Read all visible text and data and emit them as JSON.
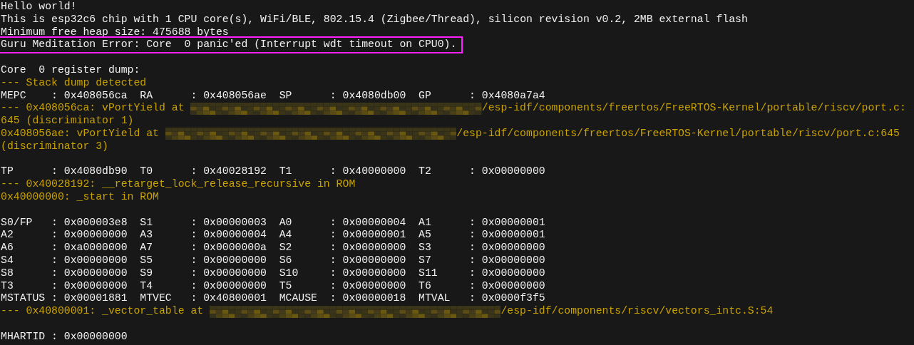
{
  "terminal": {
    "lines": [
      {
        "kind": "text",
        "text": "Hello world!"
      },
      {
        "kind": "text",
        "text": "This is esp32c6 chip with 1 CPU core(s), WiFi/BLE, 802.15.4 (Zigbee/Thread), silicon revision v0.2, 2MB external flash"
      },
      {
        "kind": "text",
        "text": "Minimum free heap size: 475688 bytes"
      },
      {
        "kind": "boxed",
        "text": "Guru Meditation Error: Core  0 panic'ed (Interrupt wdt timeout on CPU0)."
      },
      {
        "kind": "blank"
      },
      {
        "kind": "text",
        "text": "Core  0 register dump:"
      },
      {
        "kind": "note",
        "text": "--- Stack dump detected"
      },
      {
        "kind": "text",
        "text": "MEPC    : 0x408056ca  RA      : 0x408056ae  SP      : 0x4080db00  GP      : 0x4080a7a4"
      },
      {
        "kind": "redacted",
        "before": "--- 0x408056ca: vPortYield at ",
        "after": "/esp-idf/components/freertos/FreeRTOS-Kernel/portable/riscv/port.c:"
      },
      {
        "kind": "note",
        "text": "645 (discriminator 1)"
      },
      {
        "kind": "redacted",
        "before": "0x408056ae: vPortYield at ",
        "after": "/esp-idf/components/freertos/FreeRTOS-Kernel/portable/riscv/port.c:645"
      },
      {
        "kind": "note",
        "text": "(discriminator 3)"
      },
      {
        "kind": "blank"
      },
      {
        "kind": "text",
        "text": "TP      : 0x4080db90  T0      : 0x40028192  T1      : 0x40000000  T2      : 0x00000000"
      },
      {
        "kind": "note",
        "text": "--- 0x40028192: __retarget_lock_release_recursive in ROM"
      },
      {
        "kind": "note",
        "text": "0x40000000: _start in ROM"
      },
      {
        "kind": "blank"
      },
      {
        "kind": "text",
        "text": "S0/FP   : 0x000003e8  S1      : 0x00000003  A0      : 0x00000004  A1      : 0x00000001"
      },
      {
        "kind": "text",
        "text": "A2      : 0x00000000  A3      : 0x00000004  A4      : 0x00000001  A5      : 0x00000001"
      },
      {
        "kind": "text",
        "text": "A6      : 0xa0000000  A7      : 0x0000000a  S2      : 0x00000000  S3      : 0x00000000"
      },
      {
        "kind": "text",
        "text": "S4      : 0x00000000  S5      : 0x00000000  S6      : 0x00000000  S7      : 0x00000000"
      },
      {
        "kind": "text",
        "text": "S8      : 0x00000000  S9      : 0x00000000  S10     : 0x00000000  S11     : 0x00000000"
      },
      {
        "kind": "text",
        "text": "T3      : 0x00000000  T4      : 0x00000000  T5      : 0x00000000  T6      : 0x00000000"
      },
      {
        "kind": "text",
        "text": "MSTATUS : 0x00001881  MTVEC   : 0x40800001  MCAUSE  : 0x00000018  MTVAL   : 0x0000f3f5"
      },
      {
        "kind": "redacted",
        "before": "--- 0x40800001: _vector_table at ",
        "after": "/esp-idf/components/riscv/vectors_intc.S:54"
      },
      {
        "kind": "blank"
      },
      {
        "kind": "text",
        "text": "MHARTID : 0x00000000"
      }
    ]
  }
}
